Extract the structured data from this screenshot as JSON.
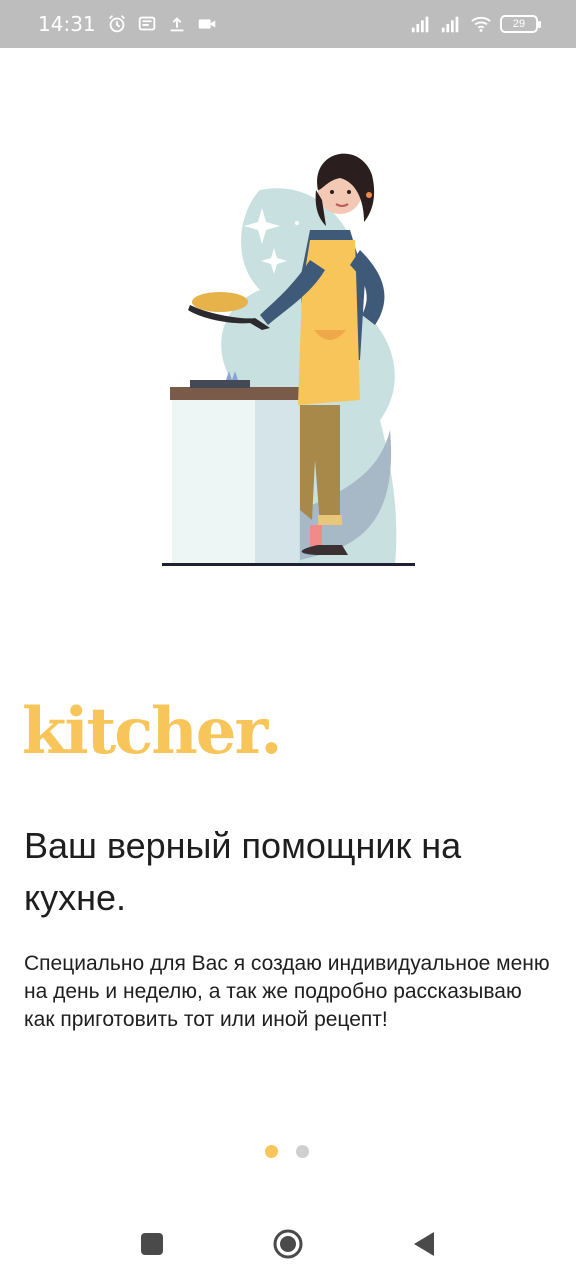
{
  "status_bar": {
    "time": "14:31",
    "battery": "29",
    "icons": [
      "alarm-icon",
      "message-icon",
      "upload-icon",
      "video-icon",
      "signal-icon",
      "signal-icon",
      "wifi-icon",
      "battery-icon"
    ]
  },
  "brand": {
    "logo_text": "kitcher.",
    "accent_color": "#f7c55a"
  },
  "onboarding": {
    "headline": "Ваш верный помощник на кухне.",
    "description": "Специально для Вас я создаю индивидуальное меню на день и неделю, а так же подробно рассказываю как приготовить тот или иной рецепт!",
    "page_index": 1,
    "page_count": 2
  },
  "navigation": {
    "buttons": [
      "recents-button",
      "home-button",
      "back-button"
    ]
  }
}
